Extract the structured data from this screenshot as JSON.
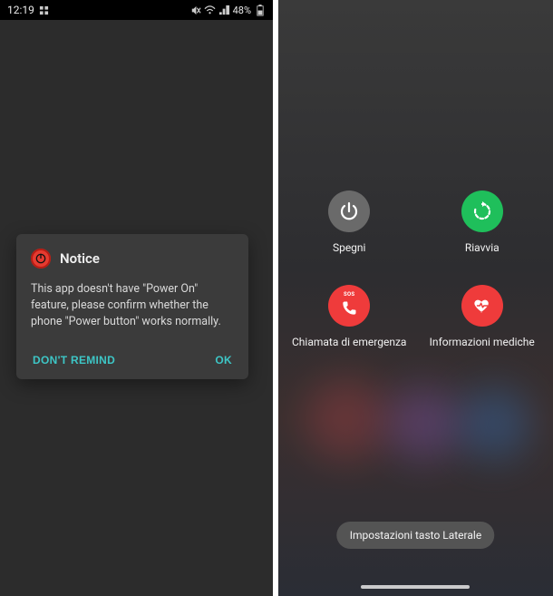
{
  "status": {
    "time": "12:19",
    "battery_text": "48%"
  },
  "dialog": {
    "title": "Notice",
    "body": "This app doesn't have \"Power On\" feature, please confirm whether the phone \"Power button\" works normally.",
    "dont_remind": "DON'T REMIND",
    "ok": "OK"
  },
  "power_menu": {
    "power_off": "Spegni",
    "restart": "Riavvia",
    "emergency_call": "Chiamata di emergenza",
    "medical_info": "Informazioni mediche",
    "sos_badge": "SOS",
    "side_key": "Impostazioni tasto Laterale"
  },
  "colors": {
    "accent_teal": "#3dc6c6",
    "green": "#1fbf5b",
    "red": "#ef3b3b"
  }
}
